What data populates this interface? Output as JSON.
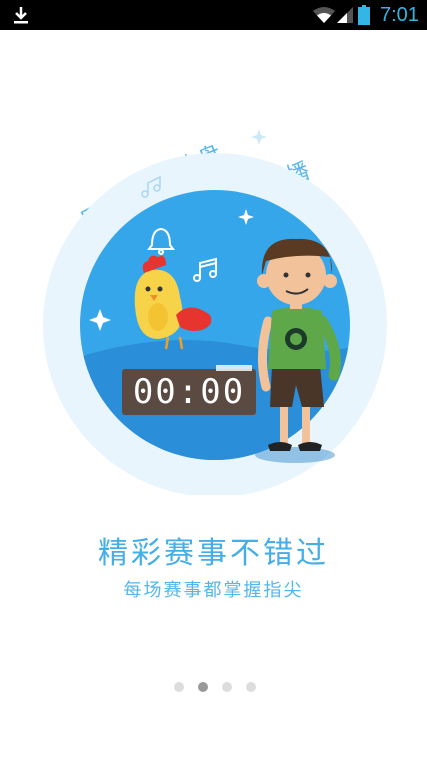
{
  "status_bar": {
    "time": "7:01",
    "icons": [
      "download-icon",
      "wifi-icon",
      "cell-signal-icon",
      "battery-icon"
    ]
  },
  "illustration": {
    "tags": [
      "图文",
      "沙盘",
      "直播"
    ],
    "clock_display": "00:00",
    "colors": {
      "accent": "#2f9fe4",
      "halo": "#e6f3fb",
      "clock_bg": "#5a4a42"
    }
  },
  "main": {
    "title": "精彩赛事不错过",
    "subtitle": "每场赛事都掌握指尖"
  },
  "pager": {
    "count": 4,
    "active_index": 1
  }
}
